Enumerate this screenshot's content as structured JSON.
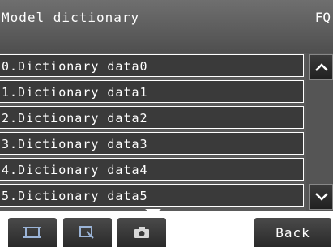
{
  "header": {
    "title": "Model dictionary",
    "brand": "FQ"
  },
  "list": {
    "items": [
      {
        "label": "0.Dictionary data0"
      },
      {
        "label": "1.Dictionary data1"
      },
      {
        "label": "2.Dictionary data2"
      },
      {
        "label": "3.Dictionary data3"
      },
      {
        "label": "4.Dictionary data4"
      },
      {
        "label": "5.Dictionary data5"
      }
    ]
  },
  "scroll": {
    "up_icon": "chevron-up-icon",
    "down_icon": "chevron-down-icon"
  },
  "footer": {
    "buttons": [
      {
        "icon": "frame-icon"
      },
      {
        "icon": "zoom-region-icon"
      },
      {
        "icon": "camera-icon"
      }
    ],
    "back_label": "Back"
  }
}
